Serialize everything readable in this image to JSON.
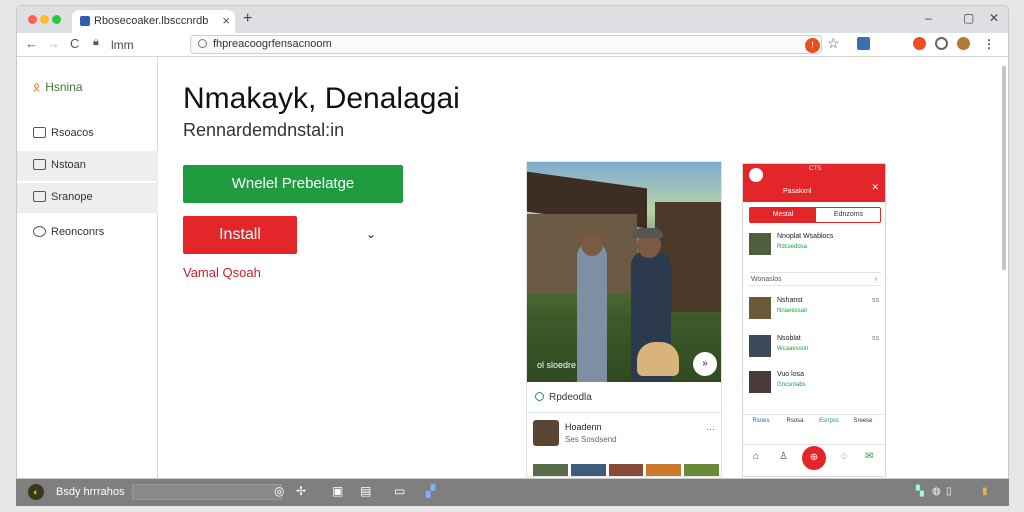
{
  "browser": {
    "tab_title": "Rbosecoaker.lbsccnrdb",
    "tab_close": "×",
    "new_tab": "+",
    "window_controls": [
      "–",
      "▢",
      "✕"
    ],
    "nav_back": "←",
    "nav_forward": "→",
    "nav_reload": "C",
    "breadcrumb": "lmm",
    "url": "fhpreacoogrfensacnoom",
    "address_badge": "!",
    "star": "☆"
  },
  "sidebar": {
    "brand": "Hsnina",
    "items": [
      {
        "label": "Rsoacos"
      },
      {
        "label": "Nstoan"
      },
      {
        "label": "Sranope"
      },
      {
        "label": "Reonconrs"
      }
    ]
  },
  "main": {
    "heading": "Nmakayk, Denalagai",
    "subheading": "Rennardemdnstal:in",
    "primary_button": "Wnelel Prebelatge",
    "install_button": "Install",
    "dropdown_caret": "⌄",
    "secondary_link": "Vamal Qsoah"
  },
  "photo_card": {
    "caption": "ol sloedre",
    "next": "»",
    "status": "Rpdeodla",
    "reviewer_name": "Hoadenn",
    "reviewer_meta": "Ses Sosdsend",
    "more": "⋯"
  },
  "phone": {
    "status_bar": "CTS",
    "title": "Pasakxnl",
    "close": "✕",
    "seg_a": "Mestal",
    "seg_b": "Ednzoms",
    "top_row": {
      "name": "Nnoplat Wsablocs",
      "sub": "Rdcsedosa"
    },
    "section": "Wonaslos",
    "section_arrow": "›",
    "rows": [
      {
        "name": "Nshanst",
        "sub": "Nnaeessan",
        "date": "ss"
      },
      {
        "name": "Nsoblat",
        "sub": "Wcaaessnn",
        "date": "ss"
      },
      {
        "name": "Vuo losa",
        "sub": "Gncsmabs",
        "date": ""
      }
    ],
    "nav_labels": [
      "Rsnes",
      "Rsosa",
      "Esnpss",
      "Sreese"
    ],
    "fab": "⊕"
  },
  "taskbar": {
    "label": "Bsdy hrrrahos",
    "start_glyph": "◐"
  },
  "colors": {
    "accent_green": "#1f9c3f",
    "accent_red": "#e3262a"
  }
}
